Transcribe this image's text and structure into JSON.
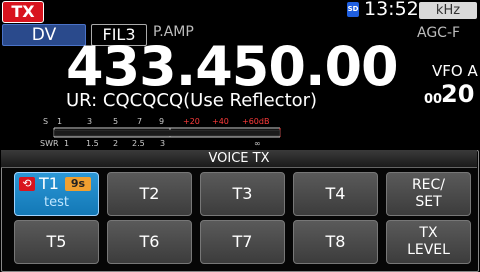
{
  "status": {
    "tx": "TX",
    "sd": "SD",
    "clock": "13:52",
    "khz": "kHz"
  },
  "row2": {
    "mode": "DV",
    "filter": "FIL3",
    "pamp": "P.AMP",
    "agc": "AGC-F"
  },
  "frequency": "433.450.00",
  "vfo": "VFO A",
  "memch": {
    "small": "00",
    "big": "20"
  },
  "ur_line": "UR: CQCQCQ(Use Reflector)",
  "meter": {
    "s_label": "S",
    "s_ticks": [
      "1",
      "3",
      "5",
      "7",
      "9"
    ],
    "s_plus": [
      "+20",
      "+40",
      "+60dB"
    ],
    "swr_label": "SWR",
    "swr_ticks": [
      "1",
      "1.5",
      "2",
      "2.5",
      "3"
    ],
    "swr_inf": "∞"
  },
  "panel": {
    "title": "VOICE TX",
    "t1": {
      "name": "T1",
      "time": "9s",
      "label": "test"
    },
    "keys": {
      "t2": "T2",
      "t3": "T3",
      "t4": "T4",
      "rec_set_1": "REC/",
      "rec_set_2": "SET",
      "t5": "T5",
      "t6": "T6",
      "t7": "T7",
      "t8": "T8",
      "tx_level_1": "TX",
      "tx_level_2": "LEVEL"
    }
  },
  "colors": {
    "tx_red": "#d8141e",
    "mode_blue": "#2a4a8c",
    "t1_blue": "#1378b6",
    "t1_time": "#f0a030"
  }
}
